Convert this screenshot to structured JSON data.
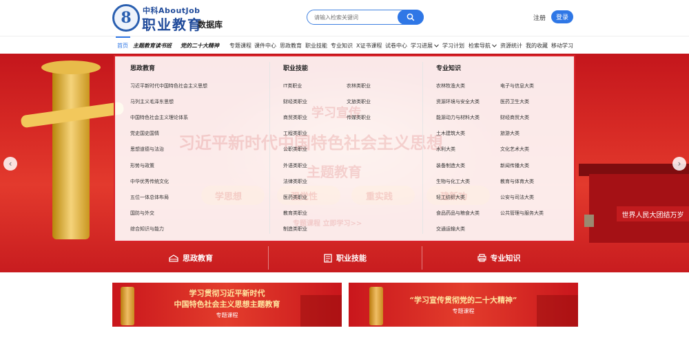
{
  "header": {
    "brand_top": "中科AboutJob",
    "brand_main": "职业教育",
    "brand_sub": "数据库",
    "logo_glyph": "8",
    "search_placeholder": "请输入检索关键词",
    "register": "注册",
    "login": "登录"
  },
  "nav": {
    "items": [
      "首页",
      "主题教育读书班",
      "党的二十大精神",
      "专题课程",
      "课件中心",
      "思政教育",
      "职业技能",
      "专业知识",
      "X证书课程",
      "试卷中心",
      "学习进展",
      "学习计划",
      "检索导航",
      "资源统计",
      "我的收藏",
      "移动学习"
    ],
    "active_index": 0
  },
  "panel": {
    "col1": {
      "title": "思政教育",
      "links": [
        "习近平新时代中国特色社会主义思想",
        "马列主义毛泽东思想",
        "中国特色社会主义理论体系",
        "党史国史国情",
        "思想道德与法治",
        "形势与政策",
        "中华优秀传统文化",
        "五位一体总体布局",
        "国防与外交",
        "综合知识与能力"
      ]
    },
    "col2": {
      "title": "职业技能",
      "left": [
        "IT类职业",
        "财经类职业",
        "商贸类职业",
        "工程类职业",
        "公职类职业",
        "外语类职业",
        "法律类职业",
        "医药类职业",
        "教育类职业",
        "制造类职业"
      ],
      "right": [
        "农林类职业",
        "文旅类职业",
        "传媒类职业"
      ]
    },
    "col3": {
      "title": "专业知识",
      "left": [
        "农林牧渔大类",
        "资源环境与安全大类",
        "能源动力与材料大类",
        "土木建筑大类",
        "水利大类",
        "装备制造大类",
        "生物与化工大类",
        "轻工纺织大类",
        "食品药品与粮食大类",
        "交通运输大类"
      ],
      "right": [
        "电子与信息大类",
        "医药卫生大类",
        "财经商贸大类",
        "旅游大类",
        "文化艺术大类",
        "新闻传播大类",
        "教育与体育大类",
        "公安与司法大类",
        "公共管理与服务大类"
      ]
    }
  },
  "hero": {
    "watermark_line1": "学习宣传",
    "watermark_line2": "习近平新时代中国特色社会主义思想",
    "watermark_line3": "主题教育",
    "pills": [
      "学思想",
      "强党性",
      "重实践",
      "建新功"
    ],
    "cta": "专题课程   立即学习>>",
    "gate_sign": "世界人民大团结万岁"
  },
  "categories": [
    "思政教育",
    "职业技能",
    "专业知识"
  ],
  "banners": {
    "left": {
      "line1": "学习贯彻习近平新时代",
      "line2": "中国特色社会主义思想主题教育",
      "line3": "专题课程"
    },
    "right": {
      "line1": "“学习宣传贯彻党的二十大精神”",
      "line2": "专题课程"
    }
  },
  "colors": {
    "accent": "#2f77e6",
    "red": "#c9161c",
    "panel_border": "#d9232a"
  },
  "icons": [
    "search-icon",
    "chevron-down-icon",
    "arrow-left-icon",
    "arrow-right-icon",
    "book-icon",
    "document-icon",
    "printer-icon"
  ]
}
